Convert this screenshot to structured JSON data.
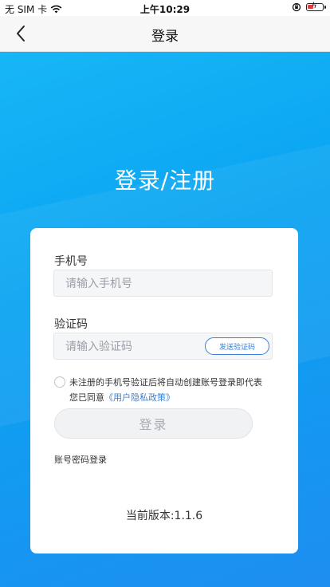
{
  "status_bar": {
    "carrier": "无 SIM 卡",
    "time": "上午10:29",
    "battery_level_percent": 40
  },
  "nav": {
    "title": "登录"
  },
  "hero": {
    "title": "登录/注册"
  },
  "form": {
    "phone": {
      "label": "手机号",
      "value": "",
      "placeholder": "请输入手机号"
    },
    "code": {
      "label": "验证码",
      "value": "",
      "placeholder": "请输入验证码",
      "send_button_label": "发送验证码"
    },
    "agreement": {
      "checked": false,
      "text_line1": "未注册的手机号验证后将自动创建账号登录即代表",
      "text_line2_prefix": "您已同意",
      "link_label": "《用户隐私政策》"
    },
    "login_button_label": "登录",
    "account_login_label": "账号密码登录",
    "version_text": "当前版本:1.1.6"
  },
  "colors": {
    "hero_gradient_start": "#17b7f6",
    "hero_gradient_end": "#1e8ef0",
    "link": "#3a7fd5",
    "disabled_button_bg": "#f1f2f4",
    "battery_low": "#e23b3b"
  },
  "icons": {
    "signal": "wifi-icon",
    "orientation": "orientation-lock-icon",
    "battery": "battery-charging-icon",
    "back": "chevron-left-icon"
  }
}
